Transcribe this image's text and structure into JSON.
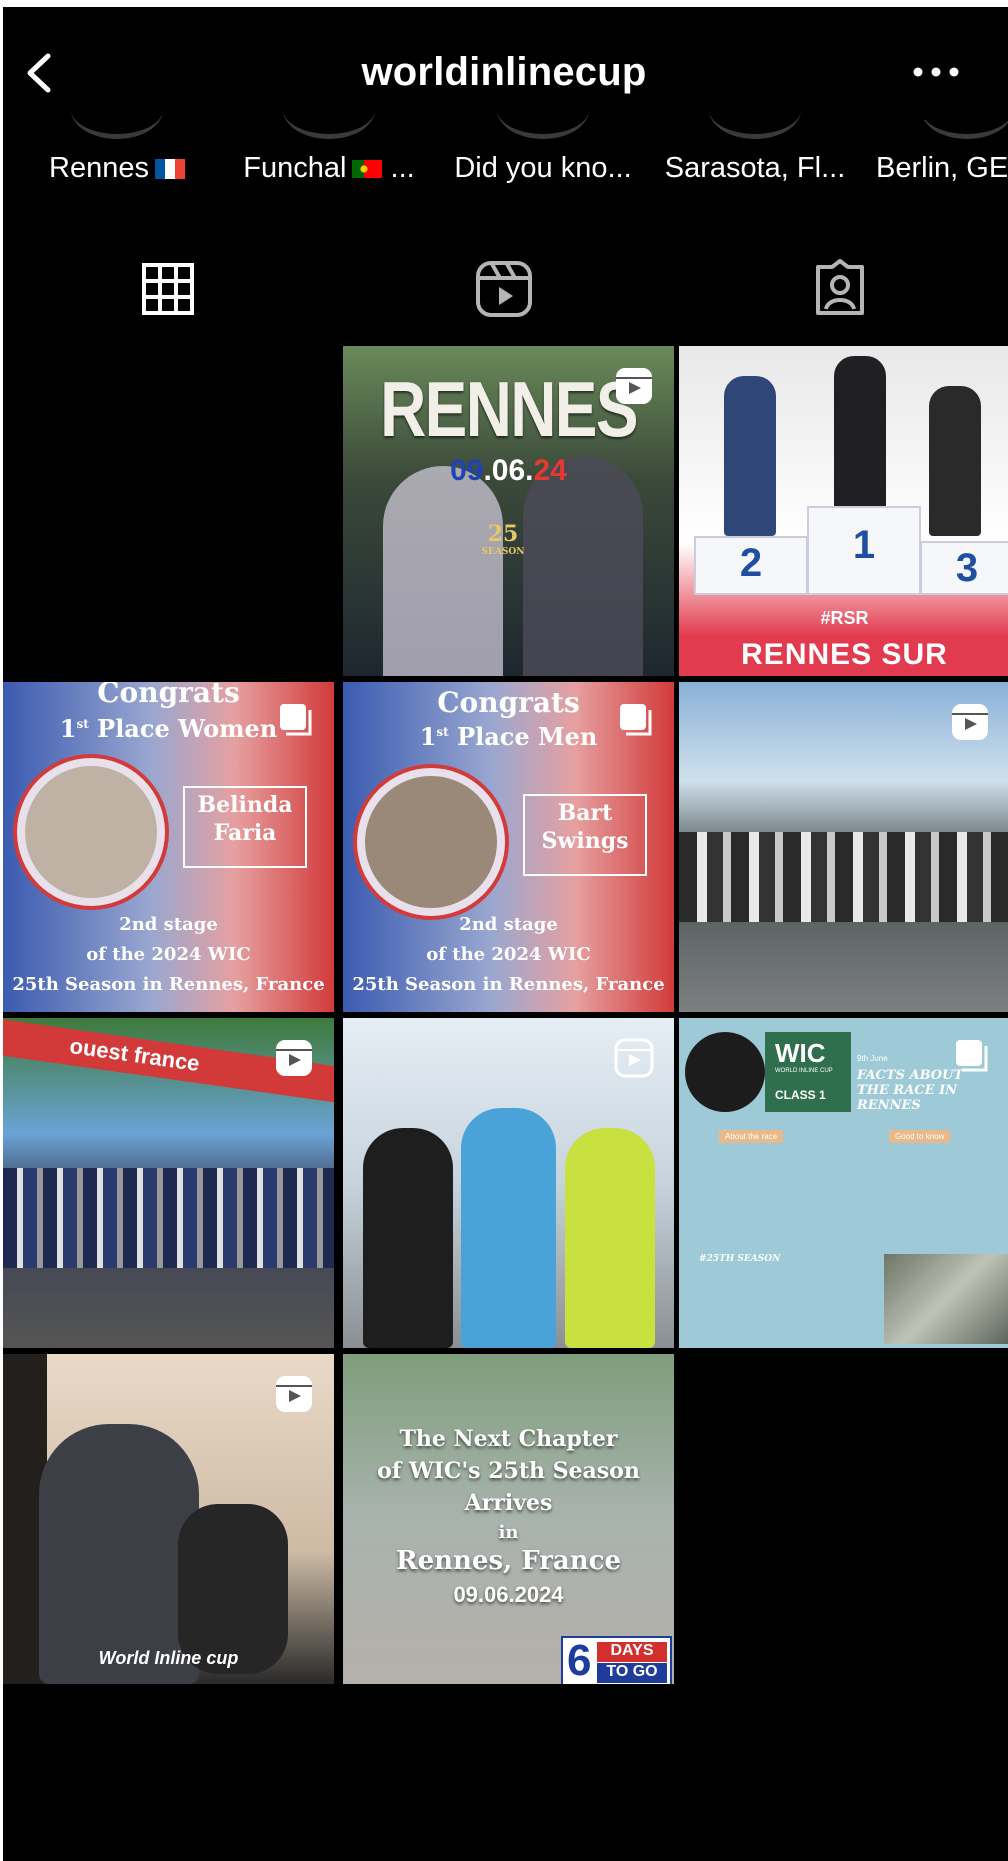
{
  "header": {
    "username": "worldinlinecup"
  },
  "highlights": [
    {
      "label": "Rennes",
      "flag": "fr"
    },
    {
      "label": "Funchal",
      "flag": "pt",
      "suffix": " ..."
    },
    {
      "label": "Did you kno..."
    },
    {
      "label": "Sarasota, Fl..."
    },
    {
      "label": "Berlin, GE"
    }
  ],
  "tabs": [
    {
      "name": "grid",
      "icon": "grid-icon"
    },
    {
      "name": "reels",
      "icon": "reels-icon"
    },
    {
      "name": "tagged",
      "icon": "tagged-icon"
    }
  ],
  "posts": {
    "p1": {
      "title": "RENNES",
      "date_a": "09",
      "date_b": ".06.",
      "date_c": "24",
      "badge": "25",
      "badge_sub": "SEASON"
    },
    "p2": {
      "place2": "2",
      "place1": "1",
      "place3": "3",
      "banner": "#RSR",
      "banner_text": "RENNES SUR ROULETTES"
    },
    "p3": {
      "head": "Congrats",
      "place_num": "1",
      "place_sup": "st",
      "place_txt": "Place Women",
      "name_1": "Belinda",
      "name_2": "Faria",
      "line1": "2nd stage",
      "line2": "of the 2024 WIC",
      "line3": "25th Season in Rennes, France"
    },
    "p4": {
      "head": "Congrats",
      "place_num": "1",
      "place_sup": "st",
      "place_txt": "Place Men",
      "name_1": "Bart",
      "name_2": "Swings",
      "line1": "2nd stage",
      "line2": "of the 2024 WIC",
      "line3": "25th Season in Rennes, France"
    },
    "p5": {},
    "p6": {
      "banner": "ouest france"
    },
    "p7": {},
    "p8": {
      "wic": "WIC",
      "wic_sub": "WORLD INLINE CUP",
      "class": "CLASS 1",
      "date": "9th June",
      "heading": "FACTS ABOUT THE RACE IN RENNES",
      "about": "About the race",
      "good": "Good to know",
      "season": "#25TH SEASON"
    },
    "p9": {
      "caption": "World Inline cup"
    },
    "p10": {
      "line1": "The Next Chapter",
      "line2": "of WIC's 25th Season",
      "line3": "Arrives",
      "line4": "in",
      "line5": "Rennes, France",
      "date": "09.06.2024",
      "days_num": "6",
      "days_a": "DAYS",
      "days_b": "TO GO"
    }
  },
  "colors": {
    "background": "#000000",
    "text": "#ffffff",
    "wic_blue": "#9dcad6",
    "red": "#e63946"
  }
}
